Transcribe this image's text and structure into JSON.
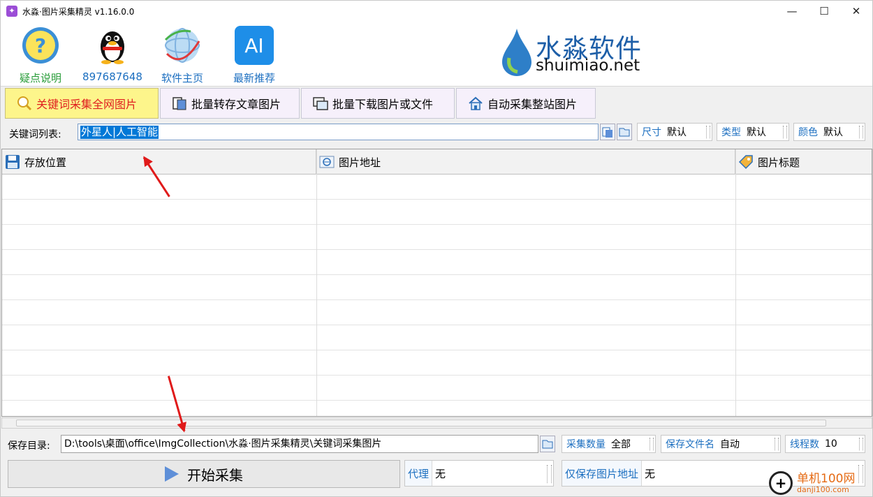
{
  "window": {
    "title": "水淼·图片采集精灵 v1.16.0.0",
    "controls": {
      "minimize": "—",
      "maximize": "☐",
      "close": "✕"
    }
  },
  "toolbar": {
    "items": [
      {
        "label": "疑点说明",
        "icon": "help-icon",
        "color": "#2a9d3a"
      },
      {
        "label": "897687648",
        "icon": "qq-penguin-icon",
        "color": "#1c6fc0"
      },
      {
        "label": "软件主页",
        "icon": "globe-icon",
        "color": "#1c6fc0"
      },
      {
        "label": "最新推荐",
        "icon": "ai-icon",
        "color": "#1c6fc0",
        "icon_text": "AI"
      }
    ]
  },
  "logo": {
    "chinese": "水淼软件",
    "english": "shuimiao.net"
  },
  "tabs": [
    {
      "label": "关键词采集全网图片",
      "icon": "keyword-search-icon",
      "active": true
    },
    {
      "label": "批量转存文章图片",
      "icon": "article-transfer-icon",
      "active": false
    },
    {
      "label": "批量下载图片或文件",
      "icon": "batch-download-icon",
      "active": false
    },
    {
      "label": "自动采集整站图片",
      "icon": "home-icon",
      "active": false
    }
  ],
  "keyword": {
    "label": "关键词列表:",
    "value": "外星人|人工智能"
  },
  "filters": [
    {
      "key": "尺寸",
      "value": "默认"
    },
    {
      "key": "类型",
      "value": "默认"
    },
    {
      "key": "颜色",
      "value": "默认"
    }
  ],
  "table": {
    "columns": [
      {
        "label": "存放位置",
        "icon": "save-disk-icon"
      },
      {
        "label": "图片地址",
        "icon": "web-address-icon"
      },
      {
        "label": "图片标题",
        "icon": "tag-icon"
      }
    ],
    "rows": []
  },
  "save": {
    "label": "保存目录:",
    "path": "D:\\tools\\桌面\\office\\ImgCollection\\水淼·图片采集精灵\\关键词采集图片"
  },
  "options": [
    {
      "key": "采集数量",
      "value": "全部"
    },
    {
      "key": "保存文件名",
      "value": "自动"
    },
    {
      "key": "线程数",
      "value": "10"
    }
  ],
  "start_button": {
    "label": "开始采集"
  },
  "proxy": {
    "key": "代理",
    "value": "无"
  },
  "save_url_only": {
    "key": "仅保存图片地址",
    "value": "无"
  },
  "watermark": {
    "text": "单机100网",
    "url": "danji100.com",
    "symbol": "+"
  },
  "colors": {
    "active_tab_bg": "#fdf58b",
    "active_tab_text": "#e02020",
    "key_blue": "#1c6fc0",
    "arrow_red": "#e01a1a"
  }
}
